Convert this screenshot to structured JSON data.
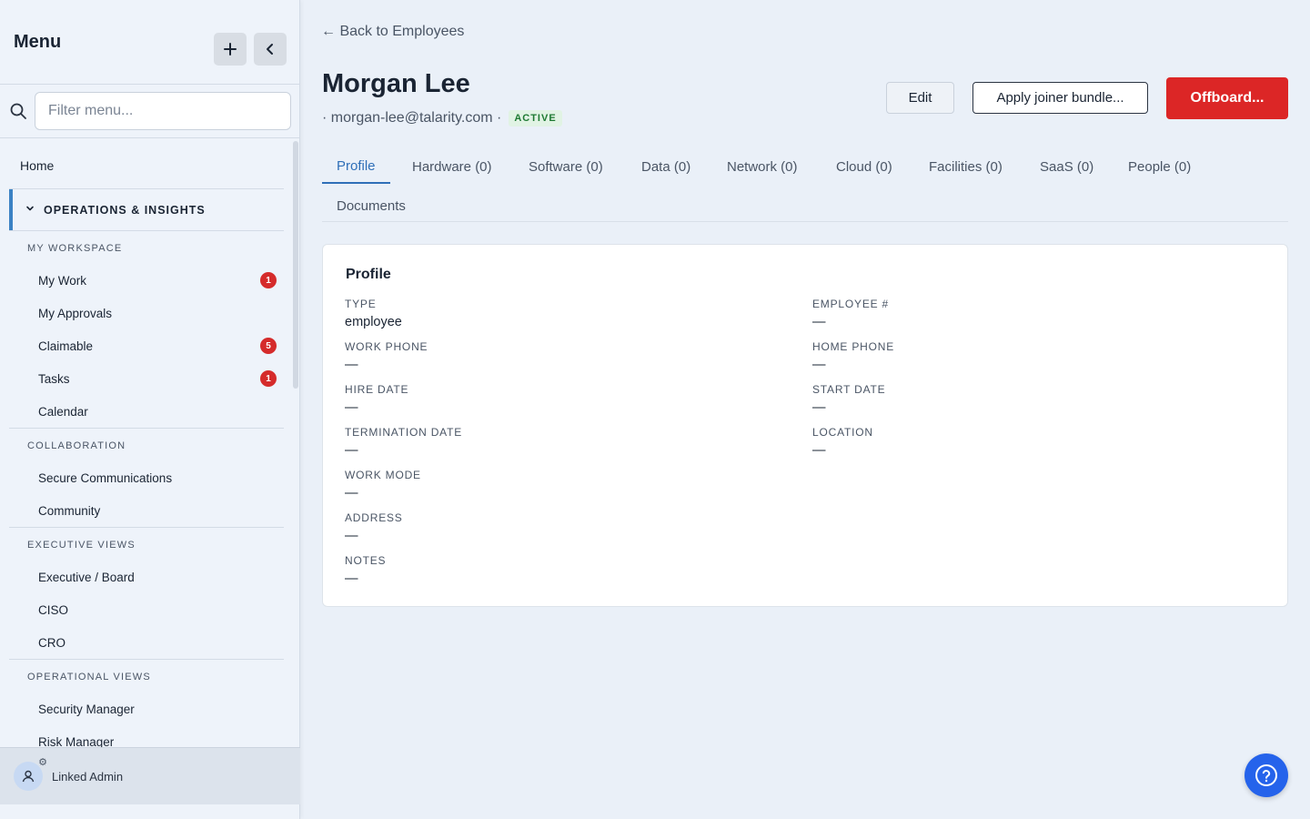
{
  "sidebar": {
    "title": "Menu",
    "add_icon": "plus-icon",
    "collapse_icon": "chevron-left-icon",
    "filter_placeholder": "Filter menu...",
    "home": "Home",
    "section": "OPERATIONS & INSIGHTS",
    "groups": [
      {
        "label": "MY WORKSPACE",
        "items": [
          {
            "label": "My Work",
            "badge": "1"
          },
          {
            "label": "My Approvals",
            "badge": ""
          },
          {
            "label": "Claimable",
            "badge": "5"
          },
          {
            "label": "Tasks",
            "badge": "1"
          },
          {
            "label": "Calendar",
            "badge": ""
          }
        ]
      },
      {
        "label": "COLLABORATION",
        "items": [
          {
            "label": "Secure Communications"
          },
          {
            "label": "Community"
          }
        ]
      },
      {
        "label": "EXECUTIVE VIEWS",
        "items": [
          {
            "label": "Executive / Board"
          },
          {
            "label": "CISO"
          },
          {
            "label": "CRO"
          }
        ]
      },
      {
        "label": "OPERATIONAL VIEWS",
        "items": [
          {
            "label": "Security Manager"
          },
          {
            "label": "Risk Manager"
          }
        ]
      }
    ],
    "footer_user": "Linked Admin"
  },
  "main": {
    "back_link": "← Back to Employees",
    "employee_name": "Morgan Lee",
    "email": "· morgan-lee@talarity.com ·",
    "status": "ACTIVE",
    "buttons": {
      "edit": "Edit",
      "joiner": "Apply joiner bundle...",
      "offboard": "Offboard..."
    },
    "tabs": [
      "Profile",
      "Hardware (0)",
      "Software (0)",
      "Data (0)",
      "Network (0)",
      "Cloud (0)",
      "Facilities (0)",
      "SaaS (0)",
      "People (0)",
      "Documents"
    ],
    "active_tab": "Profile",
    "card": {
      "title": "Profile",
      "fields": {
        "type": {
          "label": "TYPE",
          "value": "employee"
        },
        "employee_no": {
          "label": "EMPLOYEE #",
          "value": "—"
        },
        "work_phone": {
          "label": "WORK PHONE",
          "value": "—"
        },
        "home_phone": {
          "label": "HOME PHONE",
          "value": "—"
        },
        "hire_date": {
          "label": "HIRE DATE",
          "value": "—"
        },
        "start_date": {
          "label": "START DATE",
          "value": "—"
        },
        "termination_date": {
          "label": "TERMINATION DATE",
          "value": "—"
        },
        "location": {
          "label": "LOCATION",
          "value": "—"
        },
        "work_mode": {
          "label": "WORK MODE",
          "value": "—"
        },
        "address": {
          "label": "ADDRESS",
          "value": "—"
        },
        "notes": {
          "label": "NOTES",
          "value": "—"
        }
      }
    },
    "help_icon": "help-circle-icon"
  },
  "colors": {
    "accent": "#2f6fb8",
    "danger": "#dc2626",
    "status_active_bg": "#e1f3e4",
    "status_active_fg": "#1f7a33",
    "badge": "#d52b2b",
    "help_button": "#2563eb"
  }
}
